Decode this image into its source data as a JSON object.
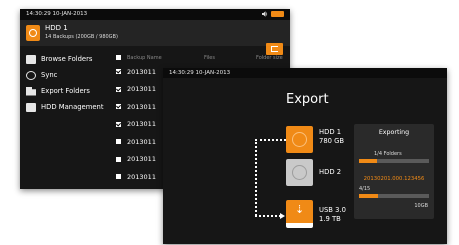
{
  "back_window": {
    "status": {
      "time": "14:30:29 10-JAN-2013",
      "icons": [
        "speaker-icon",
        "battery-icon"
      ]
    },
    "hdd": {
      "name": "HDD 1",
      "subtitle": "14 Backups (200GB / 980GB)"
    },
    "menu": [
      {
        "label": "Browse Folders",
        "icon": "folder-icon"
      },
      {
        "label": "Sync",
        "icon": "sync-icon"
      },
      {
        "label": "Export Folders",
        "icon": "export-folder-icon"
      },
      {
        "label": "HDD Management",
        "icon": "hdd-icon"
      }
    ],
    "list": {
      "headers": {
        "name": "Backup Name",
        "files": "Files",
        "size": "Folder size"
      },
      "rows": [
        {
          "name": "2013011",
          "checked": true
        },
        {
          "name": "2013011",
          "checked": true
        },
        {
          "name": "2013011",
          "checked": true
        },
        {
          "name": "2013011",
          "checked": true
        },
        {
          "name": "2013011",
          "checked": false
        },
        {
          "name": "2013011",
          "checked": false
        },
        {
          "name": "2013011",
          "checked": false
        }
      ]
    }
  },
  "front_window": {
    "status": {
      "time": "14:30:29 10-JAN-2013"
    },
    "title": "Export",
    "devices": [
      {
        "name": "HDD 1",
        "size": "780 GB",
        "color": "#f08a16"
      },
      {
        "name": "HDD 2",
        "size": "",
        "color": "#c9c9c9"
      },
      {
        "name": "USB 3.0",
        "size": "1.9 TB",
        "color": "#f08a16"
      }
    ],
    "panel": {
      "title": "Exporting",
      "folders_text": "1/4 Folders",
      "folders_progress": 0.25,
      "current_item": "20130201.000.123456",
      "files_count": "4/15",
      "files_progress": 0.27,
      "size": "10GB"
    }
  },
  "colors": {
    "accent": "#f08a16",
    "background": "#161616"
  }
}
